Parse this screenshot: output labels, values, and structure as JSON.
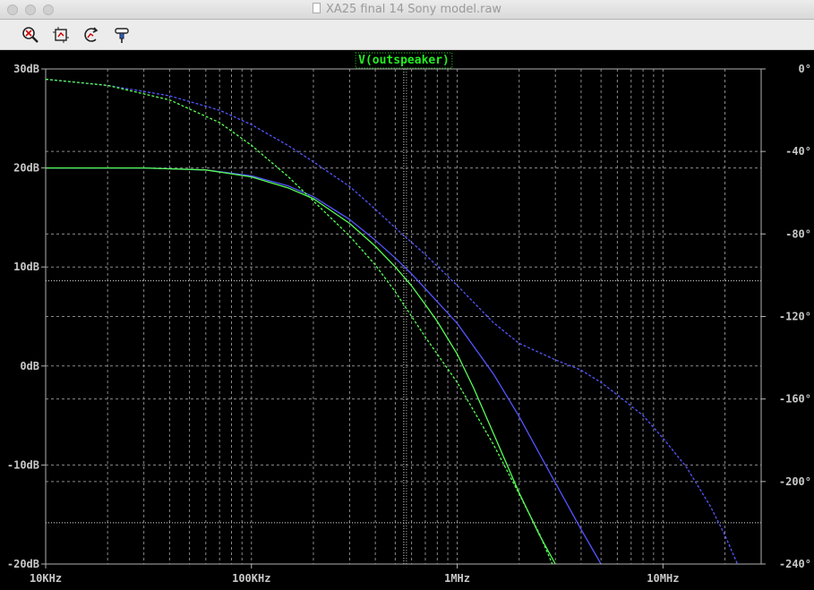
{
  "window": {
    "title": "XA25 final 14 Sony model.raw"
  },
  "toolbar": {
    "tools": [
      {
        "name": "zoom-icon"
      },
      {
        "name": "autorange-icon"
      },
      {
        "name": "undo-zoom-icon"
      },
      {
        "name": "probe-icon"
      }
    ]
  },
  "chart_data": {
    "type": "line",
    "title": "V(outspeaker)",
    "x_scale": "log",
    "xlim": [
      10000,
      30000000
    ],
    "x_ticks": [
      10000,
      100000,
      1000000,
      10000000
    ],
    "x_tick_labels": [
      "10KHz",
      "100KHz",
      "1MHz",
      "10MHz"
    ],
    "ylim": [
      -20,
      30
    ],
    "y_ticks": [
      30,
      20,
      10,
      0,
      -10,
      -20
    ],
    "y_tick_labels": [
      "30dB",
      "20dB",
      "10dB",
      "0dB",
      "-10dB",
      "-20dB"
    ],
    "y2lim": [
      -240,
      0
    ],
    "y2_ticks": [
      0,
      -40,
      -80,
      -120,
      -160,
      -200,
      -240
    ],
    "y2_tick_labels": [
      "0°",
      "-40°",
      "-80°",
      "-120°",
      "-160°",
      "-200°",
      "-240°"
    ],
    "grid": true,
    "cursor": {
      "x": 550000,
      "y": 8.6
    },
    "cursor_phase": -220,
    "series": [
      {
        "color": "#5555ff",
        "style": "solid",
        "axis": "magnitude",
        "points": [
          [
            10000,
            20
          ],
          [
            30000,
            20
          ],
          [
            60000,
            19.8
          ],
          [
            100000,
            19.2
          ],
          [
            150000,
            18.2
          ],
          [
            200000,
            17.1
          ],
          [
            300000,
            14.8
          ],
          [
            400000,
            12.7
          ],
          [
            500000,
            10.9
          ],
          [
            600000,
            9.3
          ],
          [
            700000,
            7.8
          ],
          [
            800000,
            6.5
          ],
          [
            1000000,
            4.3
          ],
          [
            1500000,
            -0.8
          ],
          [
            2000000,
            -5.1
          ],
          [
            3000000,
            -11.8
          ],
          [
            4000000,
            -16.5
          ],
          [
            5000000,
            -20
          ]
        ]
      },
      {
        "color": "#55ff55",
        "style": "solid",
        "axis": "magnitude",
        "points": [
          [
            10000,
            20
          ],
          [
            30000,
            20
          ],
          [
            60000,
            19.8
          ],
          [
            100000,
            19.1
          ],
          [
            150000,
            18
          ],
          [
            200000,
            16.9
          ],
          [
            300000,
            14.4
          ],
          [
            400000,
            12.1
          ],
          [
            500000,
            10
          ],
          [
            600000,
            8.1
          ],
          [
            700000,
            6.2
          ],
          [
            800000,
            4.5
          ],
          [
            1000000,
            1.2
          ],
          [
            1200000,
            -2.2
          ],
          [
            1500000,
            -6.8
          ],
          [
            2000000,
            -12.8
          ],
          [
            2500000,
            -17
          ],
          [
            3000000,
            -20
          ]
        ]
      },
      {
        "color": "#5555ff",
        "style": "dashed",
        "axis": "phase",
        "points": [
          [
            10000,
            -5
          ],
          [
            20000,
            -8
          ],
          [
            40000,
            -13
          ],
          [
            70000,
            -20
          ],
          [
            100000,
            -27
          ],
          [
            150000,
            -37
          ],
          [
            200000,
            -45
          ],
          [
            300000,
            -57
          ],
          [
            400000,
            -68
          ],
          [
            500000,
            -77
          ],
          [
            700000,
            -90
          ],
          [
            1000000,
            -105
          ],
          [
            1500000,
            -123
          ],
          [
            2000000,
            -133
          ],
          [
            3000000,
            -141
          ],
          [
            4000000,
            -146
          ],
          [
            5000000,
            -152
          ],
          [
            6000000,
            -158
          ],
          [
            8000000,
            -168
          ],
          [
            10000000,
            -179
          ],
          [
            13000000,
            -193
          ],
          [
            17000000,
            -212
          ],
          [
            20000000,
            -226
          ],
          [
            23000000,
            -240
          ]
        ]
      },
      {
        "color": "#55ff55",
        "style": "dashed",
        "axis": "phase",
        "points": [
          [
            10000,
            -5
          ],
          [
            20000,
            -8
          ],
          [
            40000,
            -15
          ],
          [
            70000,
            -26
          ],
          [
            100000,
            -37
          ],
          [
            150000,
            -52
          ],
          [
            200000,
            -64
          ],
          [
            300000,
            -81
          ],
          [
            400000,
            -95
          ],
          [
            500000,
            -108
          ],
          [
            700000,
            -130
          ],
          [
            1000000,
            -152
          ],
          [
            1500000,
            -182
          ],
          [
            2000000,
            -206
          ],
          [
            2500000,
            -225
          ],
          [
            2900000,
            -240
          ]
        ]
      }
    ]
  }
}
